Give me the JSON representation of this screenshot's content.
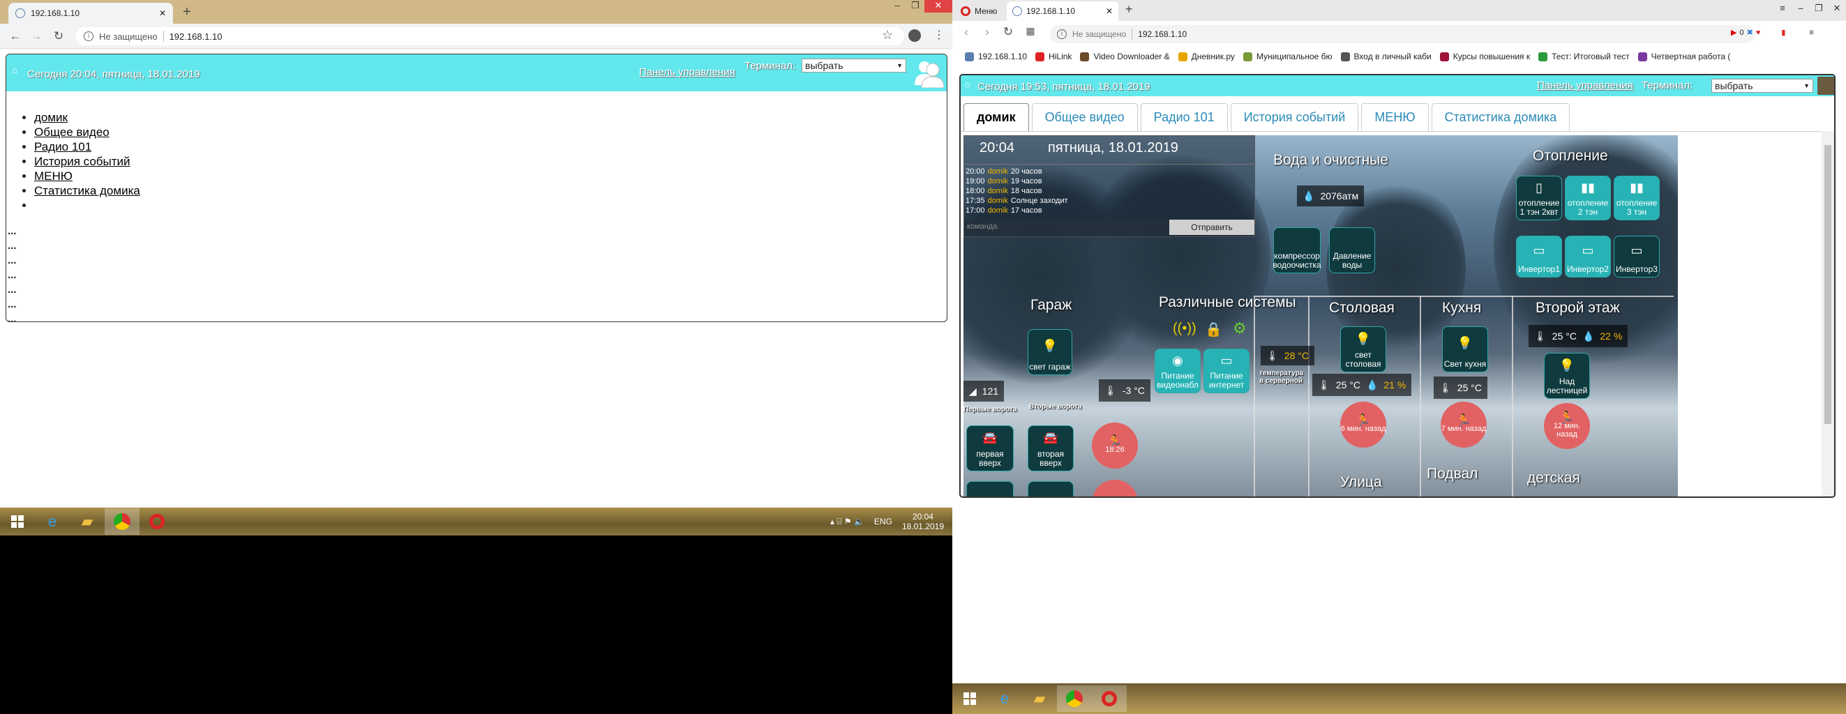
{
  "left_browser": {
    "tab_title": "192.168.1.10",
    "address_security": "Не защищено",
    "address_url": "192.168.1.10",
    "header": {
      "today": "Сегодня 20:04, пятница, 18.01.2019",
      "panel_link": "Панель управления",
      "terminal_label": "Терминал:",
      "terminal_value": "выбрать"
    },
    "menu_items": [
      "домик",
      "Общее видео",
      "Радио 101",
      "История событий",
      "МЕНЮ",
      "Статистика домика",
      ""
    ],
    "dots": [
      "...",
      "...",
      "...",
      "...",
      "...",
      "...",
      "..."
    ]
  },
  "right_browser": {
    "menu_tab": "Меню",
    "tab_title": "192.168.1.10",
    "address_security": "Не защищено",
    "address_url": "192.168.1.10",
    "adblock_count": "0",
    "bookmarks": [
      {
        "label": "192.168.1.10",
        "color": "#5a7fb0"
      },
      {
        "label": "HiLink",
        "color": "#d22"
      },
      {
        "label": "Video Downloader &",
        "color": "#6b4a2a"
      },
      {
        "label": "Дневник.ру",
        "color": "#e8a400"
      },
      {
        "label": "Муниципальное бю",
        "color": "#7a9a3a"
      },
      {
        "label": "Вход в личный каби",
        "color": "#555"
      },
      {
        "label": "Курсы повышения к",
        "color": "#a0123b"
      },
      {
        "label": "Тест: Итоговый тест",
        "color": "#2a9a3a"
      },
      {
        "label": "Четвертная работа (",
        "color": "#7a3aa0"
      }
    ],
    "header": {
      "today": "Сегодня 19:53, пятница, 18.01.2019",
      "panel_link": "Панель управления",
      "terminal_label": "Терминал:",
      "terminal_value": "выбрать"
    },
    "tabs": [
      "домик",
      "Общее видео",
      "Радио 101",
      "История событий",
      "МЕНЮ",
      "Статистика домика"
    ],
    "dashboard": {
      "time": "20:04",
      "date": "пятница, 18.01.2019",
      "log": [
        {
          "time": "20:00",
          "who": "domik",
          "text": "20 часов"
        },
        {
          "time": "19:00",
          "who": "domik",
          "text": "19 часов"
        },
        {
          "time": "18:00",
          "who": "domik",
          "text": "18 часов"
        },
        {
          "time": "17:35",
          "who": "domik",
          "text": "Солнце заходит"
        },
        {
          "time": "17:00",
          "who": "domik",
          "text": "17 часов"
        }
      ],
      "command_placeholder": "команда",
      "send_button": "Отправить",
      "water_title": "Вода и очистные",
      "pressure_value": "2076атм",
      "water_tiles": [
        "компрессор водоочистка",
        "Давление воды"
      ],
      "heating_title": "Отопление",
      "heating_tiles": [
        "отопление 1 тэн 2квт",
        "отопление 2 тэн",
        "отопление 3 тэн",
        "Инвертор1",
        "Инвертор2",
        "Инвертор3"
      ],
      "garage": {
        "title": "Гараж",
        "light": "свет гараж",
        "gate1_value": "121",
        "gate1_label": "Первые ворота",
        "gate2_label": "Вторые ворота",
        "temp": "-3 °C",
        "btn1": "первая вверх",
        "btn2": "вторая вверх",
        "motion": "18:26"
      },
      "systems": {
        "title": "Различные системы",
        "tile1": "Питание видеонабл",
        "tile2": "Питание интернет",
        "temp": "28 °C",
        "temp_label": "температура в серверной"
      },
      "dining": {
        "title": "Столовая",
        "light": "свет столовая",
        "temp": "25 °C",
        "hum": "21 %",
        "motion": "6 мин. назад"
      },
      "kitchen": {
        "title": "Кухня",
        "light": "Свет кухня",
        "temp": "25 °C",
        "motion": "7 мин. назад"
      },
      "floor2": {
        "title": "Второй этаж",
        "temp": "25 °C",
        "hum": "22 %",
        "light": "Над лестницей",
        "motion": "12 мин. назад"
      },
      "bottom_titles": [
        "Улица",
        "Подвал",
        "детская"
      ]
    }
  },
  "taskbar_left": {
    "lang": "ENG",
    "time": "20:04",
    "date": "18.01.2019"
  },
  "colors": {
    "header_cyan": "#62e8ec",
    "tile_on": "#27b3b5",
    "tile_off": "#0f3a3e",
    "motion": "#e26263",
    "humidity": "#f3b800"
  }
}
